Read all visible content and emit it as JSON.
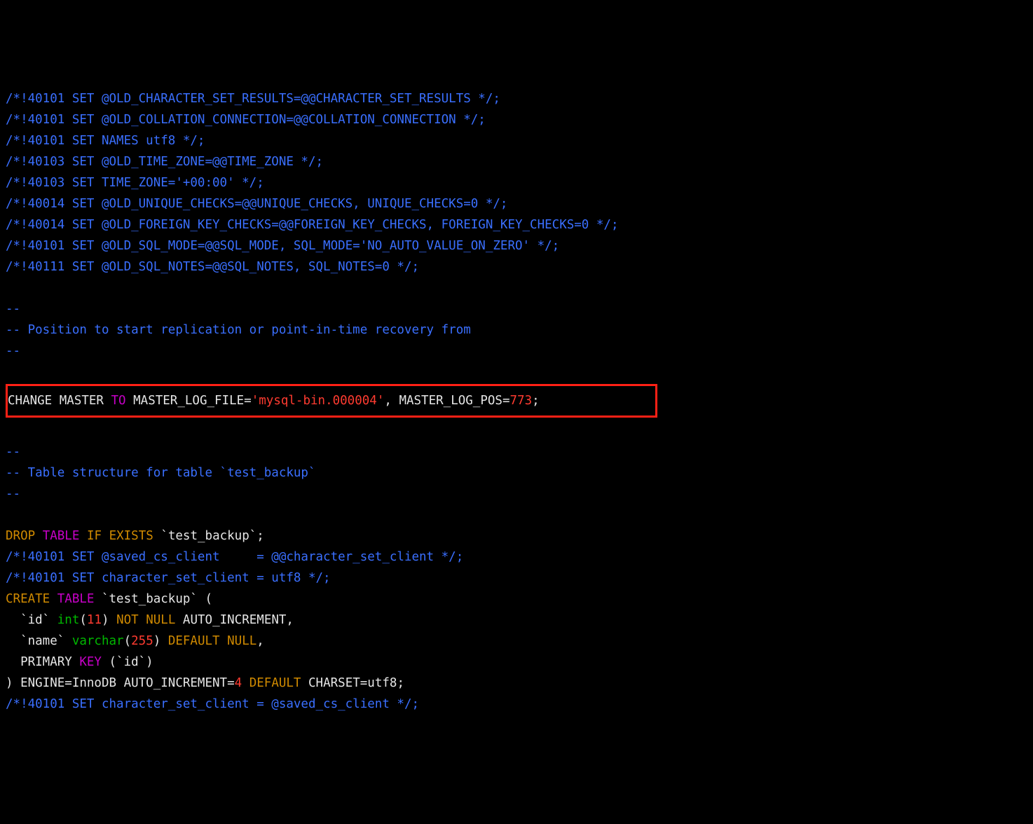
{
  "sql_dump": {
    "header_comments": [
      "/*!40101 SET @OLD_CHARACTER_SET_RESULTS=@@CHARACTER_SET_RESULTS */;",
      "/*!40101 SET @OLD_COLLATION_CONNECTION=@@COLLATION_CONNECTION */;",
      "/*!40101 SET NAMES utf8 */;",
      "/*!40103 SET @OLD_TIME_ZONE=@@TIME_ZONE */;",
      "/*!40103 SET TIME_ZONE='+00:00' */;",
      "/*!40014 SET @OLD_UNIQUE_CHECKS=@@UNIQUE_CHECKS, UNIQUE_CHECKS=0 */;",
      "/*!40014 SET @OLD_FOREIGN_KEY_CHECKS=@@FOREIGN_KEY_CHECKS, FOREIGN_KEY_CHECKS=0 */;",
      "/*!40101 SET @OLD_SQL_MODE=@@SQL_MODE, SQL_MODE='NO_AUTO_VALUE_ON_ZERO' */;",
      "/*!40111 SET @OLD_SQL_NOTES=@@SQL_NOTES, SQL_NOTES=0 */;"
    ],
    "replication_section": {
      "dash1": "--",
      "title": "-- Position to start replication or point-in-time recovery from",
      "dash2": "--"
    },
    "change_master": {
      "prefix": "CHANGE MASTER ",
      "to": "TO",
      "mid1": " MASTER_LOG_FILE=",
      "file": "'mysql-bin.000004'",
      "mid2": ", MASTER_LOG_POS=",
      "pos": "773",
      "end": ";"
    },
    "table_section": {
      "dash1": "--",
      "title": "-- Table structure for table `test_backup`",
      "dash2": "--"
    },
    "drop": {
      "drop": "DROP",
      "table": "TABLE",
      "if": "IF",
      "exists": "EXISTS",
      "name": " `test_backup`;"
    },
    "saved_cs1": "/*!40101 SET @saved_cs_client     = @@character_set_client */;",
    "saved_cs2": "/*!40101 SET character_set_client = utf8 */;",
    "create": {
      "create": "CREATE",
      "table": "TABLE",
      "open": " `test_backup` (",
      "col_id": {
        "pad": "  `id` ",
        "type": "int",
        "paren_o": "(",
        "size": "11",
        "paren_c": ") ",
        "not": "NOT",
        "sp": " ",
        "null": "NULL",
        "rest": " AUTO_INCREMENT,"
      },
      "col_name": {
        "pad": "  `name` ",
        "type": "varchar",
        "paren_o": "(",
        "size": "255",
        "paren_c": ") ",
        "default": "DEFAULT",
        "sp": " ",
        "null": "NULL",
        "comma": ","
      },
      "pk": {
        "pad": "  PRIMARY ",
        "key": "KEY",
        "rest": " (`id`)"
      },
      "close": {
        "paren": ") ENGINE=InnoDB AUTO_INCREMENT=",
        "ai": "4",
        "sp": " ",
        "default": "DEFAULT",
        "rest": " CHARSET=utf8;"
      }
    },
    "saved_cs3": "/*!40101 SET character_set_client = @saved_cs_client */;"
  }
}
